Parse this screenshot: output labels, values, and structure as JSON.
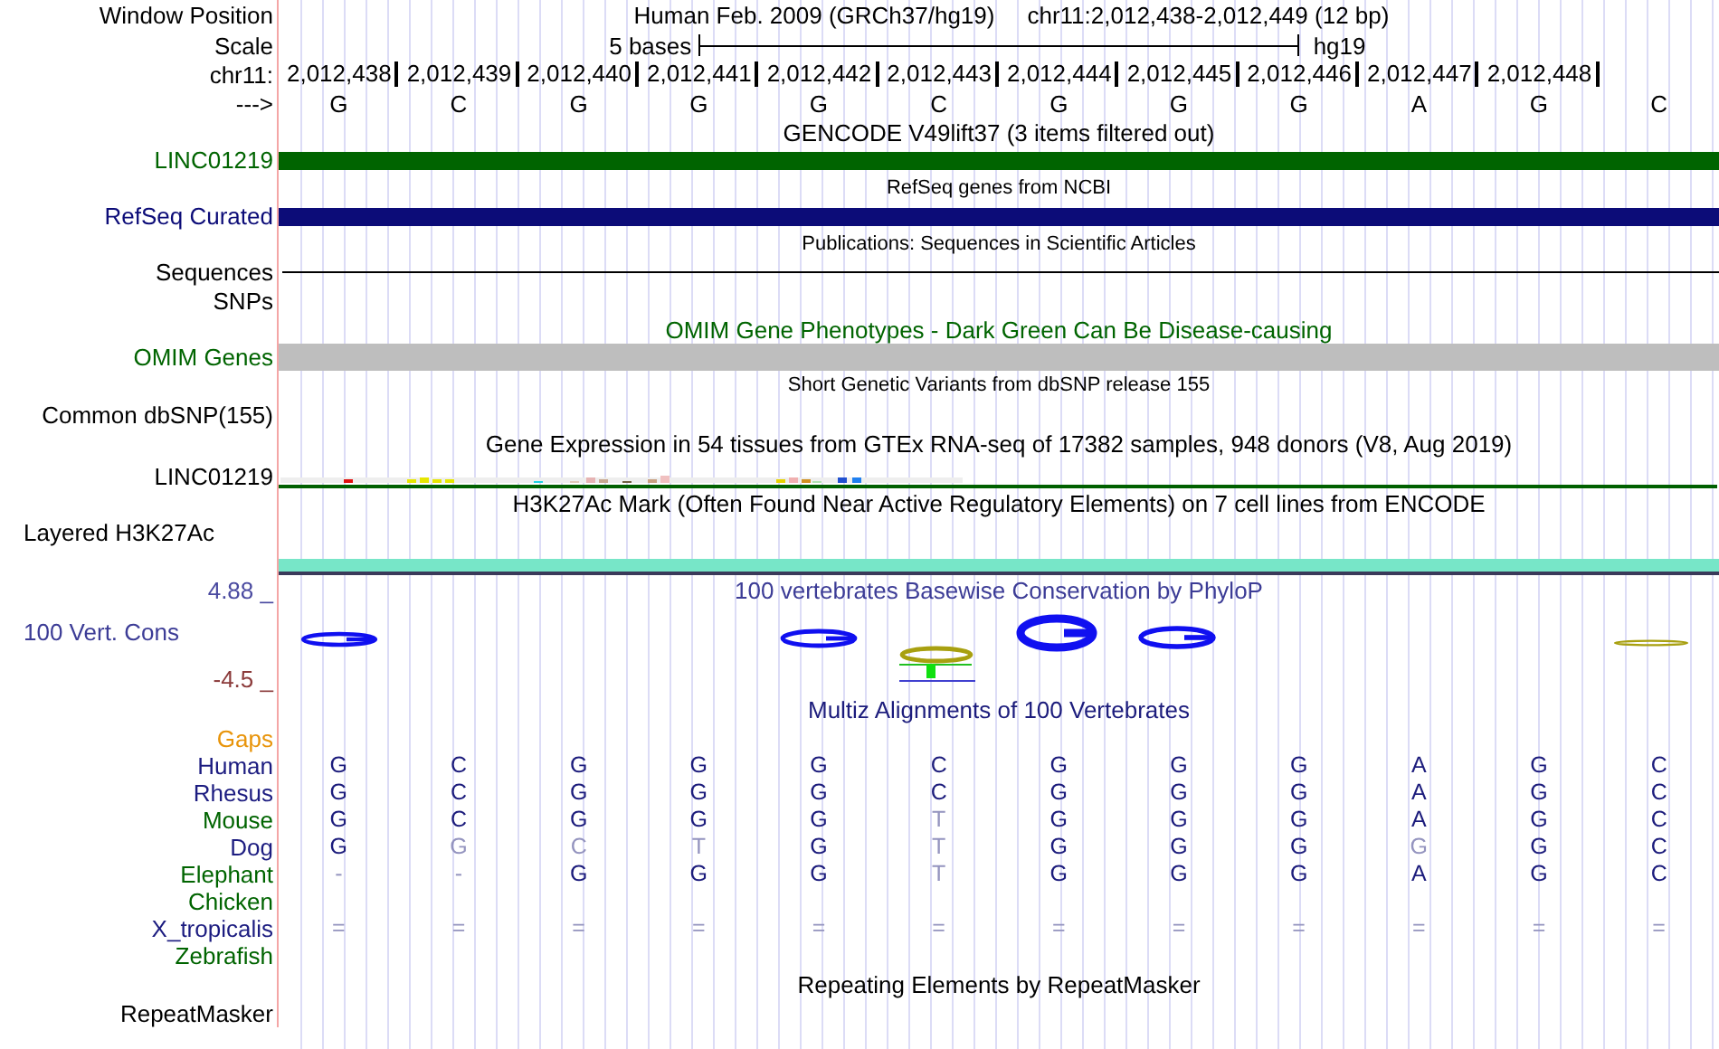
{
  "header": {
    "label": "Window Position",
    "assembly": "Human Feb. 2009 (GRCh37/hg19)",
    "position": "chr11:2,012,438-2,012,449 (12 bp)"
  },
  "scale": {
    "label": "Scale",
    "bar_label": "5 bases",
    "assembly": "hg19"
  },
  "ruler": {
    "label": "chr11:",
    "positions": [
      "2,012,438",
      "2,012,439",
      "2,012,440",
      "2,012,441",
      "2,012,442",
      "2,012,443",
      "2,012,444",
      "2,012,445",
      "2,012,446",
      "2,012,447",
      "2,012,448"
    ],
    "strand_label": "--->",
    "bases": [
      "G",
      "C",
      "G",
      "G",
      "G",
      "C",
      "G",
      "G",
      "G",
      "A",
      "G",
      "C"
    ]
  },
  "tracks": [
    {
      "kind": "title",
      "title": "GENCODE V49lift37 (3 items filtered out)"
    },
    {
      "kind": "bar",
      "label": "LINC01219",
      "color": "#006400"
    },
    {
      "kind": "caption",
      "title": "RefSeq genes from NCBI"
    },
    {
      "kind": "bar",
      "label": "RefSeq Curated",
      "color": "#0c0c78"
    },
    {
      "kind": "caption",
      "title": "Publications: Sequences in Scientific Articles"
    },
    {
      "kind": "line",
      "label": "Sequences"
    },
    {
      "kind": "empty",
      "label": "SNPs"
    },
    {
      "kind": "title",
      "title": "OMIM Gene Phenotypes - Dark Green Can Be Disease-causing",
      "color": "#006400"
    },
    {
      "kind": "block",
      "label": "OMIM Genes",
      "color": "#006400"
    },
    {
      "kind": "caption",
      "title": "Short Genetic Variants from dbSNP release 155"
    },
    {
      "kind": "empty",
      "label": "Common dbSNP(155)"
    },
    {
      "kind": "title",
      "title": "Gene Expression in 54 tissues from GTEx RNA-seq of 17382 samples, 948 donors (V8, Aug 2019)"
    },
    {
      "kind": "expression",
      "label": "LINC01219"
    },
    {
      "kind": "title",
      "title": "H3K27Ac Mark (Often Found Near Active Regulatory Elements) on 7 cell lines from ENCODE"
    },
    {
      "kind": "layered",
      "label": "Layered H3K27Ac",
      "color": "#77e6c8"
    },
    {
      "kind": "conservation",
      "title": "100 vertebrates Basewise Conservation by PhyloP",
      "label": "100 Vert. Cons",
      "max_label": "4.88 _",
      "min_label": "-4.5 _"
    },
    {
      "kind": "title",
      "title": "Multiz Alignments of 100 Vertebrates",
      "color": "#1c1c7c"
    },
    {
      "kind": "empty",
      "label": "Gaps",
      "color": "#e8940a"
    },
    {
      "kind": "alignment",
      "label": "Human",
      "color": "#1c1c80",
      "bases": [
        {
          "base": "G",
          "dim": false
        },
        {
          "base": "C",
          "dim": false
        },
        {
          "base": "G",
          "dim": false
        },
        {
          "base": "G",
          "dim": false
        },
        {
          "base": "G",
          "dim": false
        },
        {
          "base": "C",
          "dim": false
        },
        {
          "base": "G",
          "dim": false
        },
        {
          "base": "G",
          "dim": false
        },
        {
          "base": "G",
          "dim": false
        },
        {
          "base": "A",
          "dim": false
        },
        {
          "base": "G",
          "dim": false
        },
        {
          "base": "C",
          "dim": false
        }
      ]
    },
    {
      "kind": "alignment",
      "label": "Rhesus",
      "color": "#1c1c80",
      "bases": [
        {
          "base": "G",
          "dim": false
        },
        {
          "base": "C",
          "dim": false
        },
        {
          "base": "G",
          "dim": false
        },
        {
          "base": "G",
          "dim": false
        },
        {
          "base": "G",
          "dim": false
        },
        {
          "base": "C",
          "dim": false
        },
        {
          "base": "G",
          "dim": false
        },
        {
          "base": "G",
          "dim": false
        },
        {
          "base": "G",
          "dim": false
        },
        {
          "base": "A",
          "dim": false
        },
        {
          "base": "G",
          "dim": false
        },
        {
          "base": "C",
          "dim": false
        }
      ]
    },
    {
      "kind": "alignment",
      "label": "Mouse",
      "color": "#006400",
      "bases": [
        {
          "base": "G",
          "dim": false
        },
        {
          "base": "C",
          "dim": false
        },
        {
          "base": "G",
          "dim": false
        },
        {
          "base": "G",
          "dim": false
        },
        {
          "base": "G",
          "dim": false
        },
        {
          "base": "T",
          "dim": true
        },
        {
          "base": "G",
          "dim": false
        },
        {
          "base": "G",
          "dim": false
        },
        {
          "base": "G",
          "dim": false
        },
        {
          "base": "A",
          "dim": false
        },
        {
          "base": "G",
          "dim": false
        },
        {
          "base": "C",
          "dim": false
        }
      ]
    },
    {
      "kind": "alignment",
      "label": "Dog",
      "color": "#1c1c80",
      "bases": [
        {
          "base": "G",
          "dim": false
        },
        {
          "base": "G",
          "dim": true
        },
        {
          "base": "C",
          "dim": true
        },
        {
          "base": "T",
          "dim": true
        },
        {
          "base": "G",
          "dim": false
        },
        {
          "base": "T",
          "dim": true
        },
        {
          "base": "G",
          "dim": false
        },
        {
          "base": "G",
          "dim": false
        },
        {
          "base": "G",
          "dim": false
        },
        {
          "base": "G",
          "dim": true
        },
        {
          "base": "G",
          "dim": false
        },
        {
          "base": "C",
          "dim": false
        }
      ]
    },
    {
      "kind": "alignment",
      "label": "Elephant",
      "color": "#006400",
      "bases": [
        {
          "base": "-",
          "dim": true
        },
        {
          "base": "-",
          "dim": true
        },
        {
          "base": "G",
          "dim": false
        },
        {
          "base": "G",
          "dim": false
        },
        {
          "base": "G",
          "dim": false
        },
        {
          "base": "T",
          "dim": true
        },
        {
          "base": "G",
          "dim": false
        },
        {
          "base": "G",
          "dim": false
        },
        {
          "base": "G",
          "dim": false
        },
        {
          "base": "A",
          "dim": false
        },
        {
          "base": "G",
          "dim": false
        },
        {
          "base": "C",
          "dim": false
        }
      ]
    },
    {
      "kind": "alignment",
      "label": "Chicken",
      "color": "#006400"
    },
    {
      "kind": "alignment",
      "label": "X_tropicalis",
      "color": "#1c1c80",
      "bases": [
        {
          "base": "=",
          "dim": true
        },
        {
          "base": "=",
          "dim": true
        },
        {
          "base": "=",
          "dim": true
        },
        {
          "base": "=",
          "dim": true
        },
        {
          "base": "=",
          "dim": true
        },
        {
          "base": "=",
          "dim": true
        },
        {
          "base": "=",
          "dim": true
        },
        {
          "base": "=",
          "dim": true
        },
        {
          "base": "=",
          "dim": true
        },
        {
          "base": "=",
          "dim": true
        },
        {
          "base": "=",
          "dim": true
        },
        {
          "base": "=",
          "dim": true
        }
      ]
    },
    {
      "kind": "alignment",
      "label": "Zebrafish",
      "color": "#006400"
    },
    {
      "kind": "title",
      "title": "Repeating Elements by RepeatMasker"
    },
    {
      "kind": "empty",
      "label": "RepeatMasker"
    }
  ]
}
